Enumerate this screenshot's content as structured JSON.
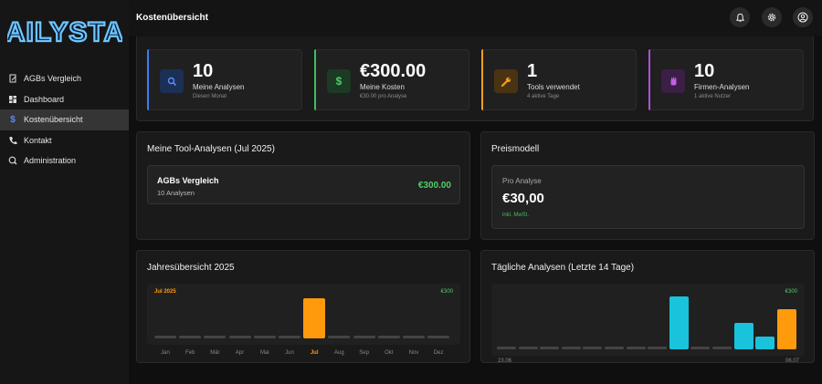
{
  "app": {
    "logo_text": "AILYSTA"
  },
  "sidebar": {
    "items": [
      {
        "label": "AGBs Vergleich",
        "icon": "document-icon",
        "active": false
      },
      {
        "label": "Dashboard",
        "icon": "dashboard-icon",
        "active": false
      },
      {
        "label": "Kostenübersicht",
        "icon": "dollar-icon",
        "active": true
      },
      {
        "label": "Kontakt",
        "icon": "phone-icon",
        "active": false
      },
      {
        "label": "Administration",
        "icon": "admin-icon",
        "active": false
      }
    ]
  },
  "header": {
    "title": "Kostenübersicht"
  },
  "stats": [
    {
      "value": "10",
      "label": "Meine Analysen",
      "sub": "Diesen Monat",
      "color": "#3b7cf5",
      "icon": "search-icon"
    },
    {
      "value": "€300.00",
      "label": "Meine Kosten",
      "sub": "€30.00 pro Analyse",
      "color": "#3fbf5f",
      "icon": "dollar-icon"
    },
    {
      "value": "1",
      "label": "Tools verwendet",
      "sub": "4 aktive Tage",
      "color": "#f5a01a",
      "icon": "wrench-icon"
    },
    {
      "value": "10",
      "label": "Firmen-Analysen",
      "sub": "1 aktive Nutzer",
      "color": "#b34fd6",
      "icon": "hand-icon"
    }
  ],
  "tool_analyses": {
    "title": "Meine Tool-Analysen (Jul 2025)",
    "item_name": "AGBs Vergleich",
    "item_count": "10 Analysen",
    "item_cost": "€300.00"
  },
  "pricing": {
    "title": "Preismodell",
    "label": "Pro Analyse",
    "price": "€30,00",
    "note": "inkl. MwSt."
  },
  "chart_data": [
    {
      "type": "bar",
      "title": "Jahresübersicht 2025",
      "categories": [
        "Jan",
        "Feb",
        "Mär",
        "Apr",
        "Mai",
        "Jun",
        "Jul",
        "Aug",
        "Sep",
        "Okt",
        "Nov",
        "Dez"
      ],
      "values": [
        0,
        0,
        0,
        0,
        0,
        0,
        300,
        0,
        0,
        0,
        0,
        0
      ],
      "highlight_label": "Jul 2025",
      "max_label": "€300",
      "ylim": [
        0,
        300
      ],
      "highlight_color": "#ff9a0d"
    },
    {
      "type": "bar",
      "title": "Tägliche Analysen (Letzte 14 Tage)",
      "values": [
        0,
        0,
        0,
        0,
        0,
        0,
        0,
        0,
        5,
        0,
        0,
        2.5,
        1.2,
        3.8
      ],
      "start_label": "23.06",
      "end_label": "06.07",
      "max_label": "€300",
      "ylim": [
        0,
        5
      ],
      "colors": [
        "#444",
        "#444",
        "#444",
        "#444",
        "#444",
        "#444",
        "#444",
        "#444",
        "#19c3dc",
        "#444",
        "#444",
        "#19c3dc",
        "#19c3dc",
        "#ff9a0d"
      ]
    }
  ]
}
